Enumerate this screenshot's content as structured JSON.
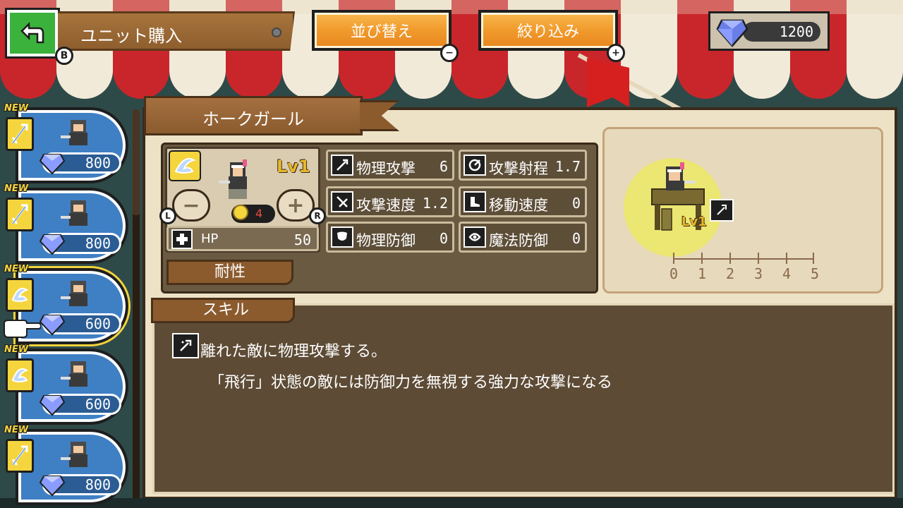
{
  "header": {
    "title": "ユニット購入",
    "back_hint": "B",
    "sort_label": "並び替え",
    "sort_hint": "−",
    "filter_label": "絞り込み",
    "filter_hint": "+",
    "gems": "1200"
  },
  "sidebar": {
    "units": [
      {
        "badge": "NEW",
        "price": "800",
        "sprite": "viking-warrior",
        "class_icon": "sword-class-icon",
        "selected": false
      },
      {
        "badge": "NEW",
        "price": "800",
        "sprite": "green-archer",
        "class_icon": "sword-class-icon",
        "selected": false
      },
      {
        "badge": "NEW",
        "price": "600",
        "sprite": "hawk-girl",
        "class_icon": "wind-class-icon",
        "selected": true
      },
      {
        "badge": "NEW",
        "price": "600",
        "sprite": "green-thief",
        "class_icon": "wind-class-icon",
        "selected": false
      },
      {
        "badge": "NEW",
        "price": "800",
        "sprite": "black-ninja",
        "class_icon": "sword-class-icon",
        "selected": false
      }
    ]
  },
  "unit": {
    "name": "ホークガール",
    "level": "Lv1",
    "cost": "4",
    "level_down_hint": "L",
    "level_up_hint": "R",
    "hp_label": "HP",
    "hp_value": "50",
    "resistance_label": "耐性",
    "stats": {
      "phys_attack": {
        "label": "物理攻撃",
        "value": "6"
      },
      "attack_range": {
        "label": "攻撃射程",
        "value": "1.7"
      },
      "attack_speed": {
        "label": "攻撃速度",
        "value": "1.2"
      },
      "move_speed": {
        "label": "移動速度",
        "value": "0"
      },
      "phys_defense": {
        "label": "物理防御",
        "value": "0"
      },
      "magic_defense": {
        "label": "魔法防御",
        "value": "0"
      }
    },
    "preview_level": "Lv1",
    "range_ruler": [
      "0",
      "1",
      "2",
      "3",
      "4",
      "5"
    ]
  },
  "skill": {
    "tab_label": "スキル",
    "line1": "離れた敵に物理攻撃する。",
    "line2": "「飛行」状態の敵には防御力を無視する強力な攻撃になる"
  },
  "colors": {
    "accent_orange": "#f19a2c",
    "back_green": "#3bb23b",
    "card_blue": "#3f7fc4",
    "gold": "#f4d53e",
    "awning_red": "#c9262b"
  }
}
